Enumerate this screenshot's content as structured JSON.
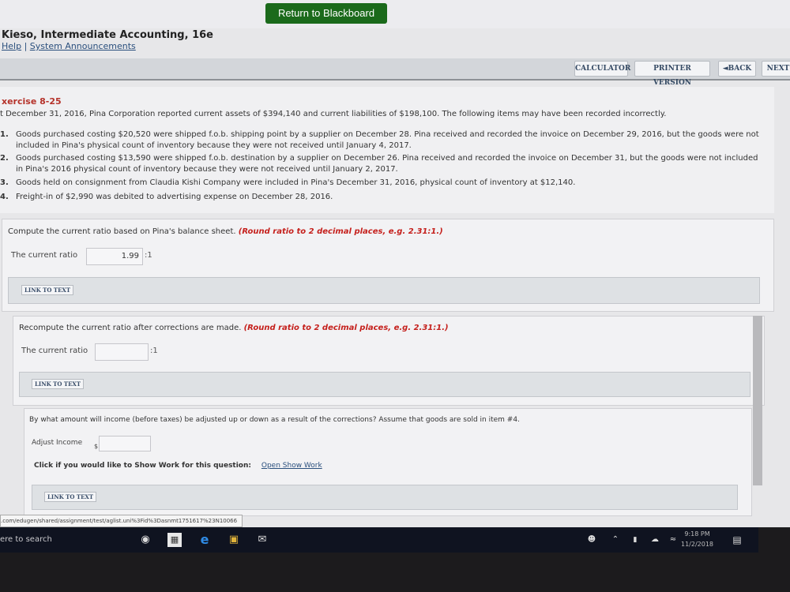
{
  "header": {
    "return_label": "Return to Blackboard",
    "book_title": "Kieso, Intermediate Accounting, 16e",
    "help_link": "Help",
    "separator": "|",
    "announcements_link": "System Announcements"
  },
  "toolbar": {
    "calculator": "CALCULATOR",
    "printer": "PRINTER VERSION",
    "back": "◄BACK",
    "next": "NEXT"
  },
  "exercise": {
    "title": "xercise 8-25",
    "intro": "t December 31, 2016, Pina Corporation reported current assets of $394,140 and current liabilities of $198,100. The following items may have been recorded incorrectly.",
    "items": [
      {
        "num": "1.",
        "text": "Goods purchased costing $20,520 were shipped f.o.b. shipping point by a supplier on December 28. Pina received and recorded the invoice on December 29, 2016, but the goods were not included in Pina's physical count of inventory because they were not received until January 4, 2017."
      },
      {
        "num": "2.",
        "text": "Goods purchased costing $13,590 were shipped f.o.b. destination by a supplier on December 26. Pina received and recorded the invoice on December 31, but the goods were not included in Pina's 2016 physical count of inventory because they were not received until January 2, 2017."
      },
      {
        "num": "3.",
        "text": "Goods held on consignment from Claudia Kishi Company were included in Pina's December 31, 2016, physical count of inventory at $12,140."
      },
      {
        "num": "4.",
        "text": "Freight-in of $2,990 was debited to advertising expense on December 28, 2016."
      }
    ]
  },
  "q1": {
    "prompt": "Compute the current ratio based on Pina's balance sheet.",
    "hint": "(Round ratio to 2 decimal places, e.g. 2.31:1.)",
    "label": "The current ratio",
    "value": "1.99",
    "suffix": ":1",
    "link": "LINK TO TEXT"
  },
  "q2": {
    "prompt": "Recompute the current ratio after corrections are made.",
    "hint": "(Round ratio to 2 decimal places, e.g. 2.31:1.)",
    "label": "The current ratio",
    "value": "",
    "suffix": ":1",
    "link": "LINK TO TEXT"
  },
  "q3": {
    "prompt": "By what amount will income (before taxes) be adjusted up or down as a result of the corrections? Assume that goods are sold in item #4.",
    "label": "Adjust Income",
    "currency": "$",
    "value": "",
    "show_work_text": "Click if you would like to Show Work for this question:",
    "show_work_link": "Open Show Work",
    "link": "LINK TO TEXT"
  },
  "status_url": ".com/edugen/shared/assignment/test/aglist.uni%3Fid%3Dasnmt1751617%23N10066",
  "taskbar": {
    "search": "ere to search",
    "time": "9:18 PM",
    "date": "11/2/2018"
  },
  "colors": {
    "return_button": "#1b6a1b",
    "hint_red": "#c5201c",
    "exercise_title": "#b5322a"
  }
}
